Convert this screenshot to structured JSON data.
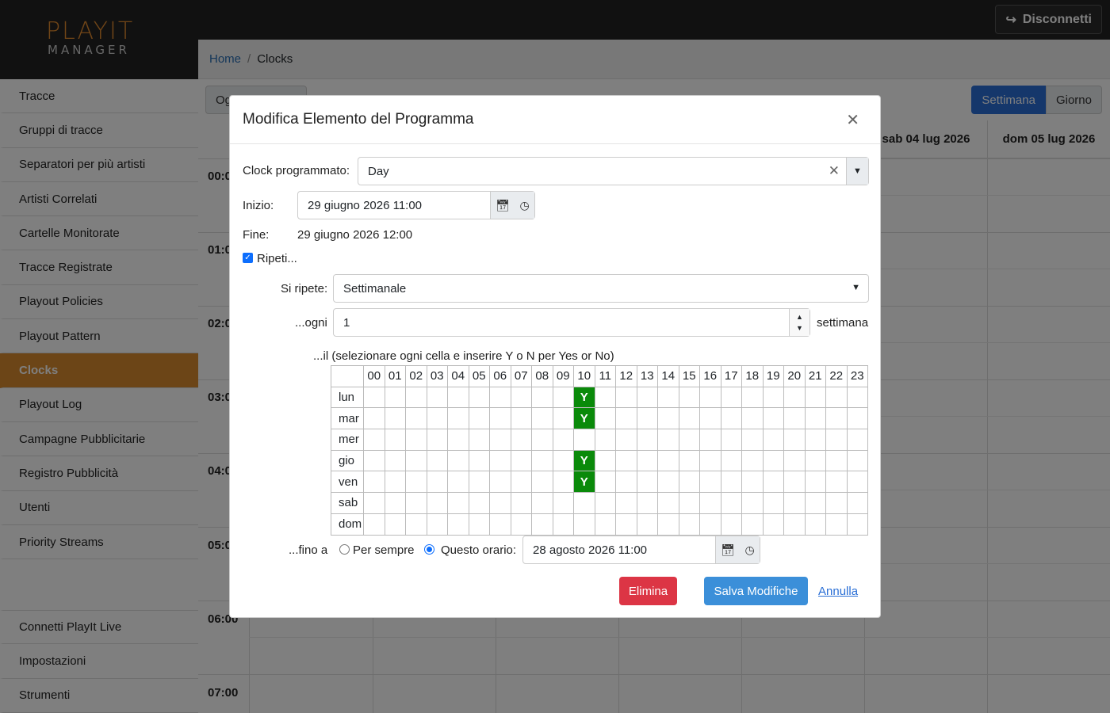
{
  "app": {
    "logo_main": "PLAYIT",
    "logo_sub": "MANAGER",
    "logout_label": "Disconnetti"
  },
  "breadcrumb": {
    "home": "Home",
    "current": "Clocks"
  },
  "sidebar": {
    "items": [
      {
        "label": "Tracce"
      },
      {
        "label": "Gruppi di tracce"
      },
      {
        "label": "Separatori per più artisti"
      },
      {
        "label": "Artisti Correlati"
      },
      {
        "label": "Cartelle Monitorate"
      },
      {
        "label": "Tracce Registrate"
      },
      {
        "label": "Playout Policies"
      },
      {
        "label": "Playout Pattern"
      },
      {
        "label": "Clocks"
      },
      {
        "label": "Playout Log"
      },
      {
        "label": "Campagne Pubblicitarie"
      },
      {
        "label": "Registro Pubblicità"
      },
      {
        "label": "Utenti"
      },
      {
        "label": "Priority Streams"
      }
    ],
    "bottom": [
      {
        "label": "Connetti PlayIt Live"
      },
      {
        "label": "Impostazioni"
      },
      {
        "label": "Strumenti"
      }
    ]
  },
  "calendar": {
    "today_btn": "Og",
    "view_week": "Settimana",
    "view_day": "Giorno",
    "col_sat": "sab 04 lug 2026",
    "col_sun": "dom 05 lug 2026",
    "hours": [
      "00:0",
      "01:0",
      "02:0",
      "03:0",
      "04:0",
      "05:0",
      "06:00",
      "07:00"
    ]
  },
  "modal": {
    "title": "Modifica Elemento del Programma",
    "clock_label": "Clock programmato:",
    "clock_value": "Day",
    "start_label": "Inizio:",
    "start_value": "29 giugno 2026 11:00",
    "end_label": "Fine:",
    "end_value": "29 giugno 2026 12:00",
    "repeat_label": "Ripeti...",
    "repeats_label": "Si ripete:",
    "repeats_value": "Settimanale",
    "every_label": "...ogni",
    "every_value": "1",
    "every_unit": "settimana",
    "grid_label": "...il (selezionare ogni cella e inserire Y o N per Yes or No)",
    "hours": [
      "00",
      "01",
      "02",
      "03",
      "04",
      "05",
      "06",
      "07",
      "08",
      "09",
      "10",
      "11",
      "12",
      "13",
      "14",
      "15",
      "16",
      "17",
      "18",
      "19",
      "20",
      "21",
      "22",
      "23"
    ],
    "days": [
      {
        "label": "lun",
        "yes_hours": [
          10
        ]
      },
      {
        "label": "mar",
        "yes_hours": [
          10
        ]
      },
      {
        "label": "mer",
        "yes_hours": []
      },
      {
        "label": "gio",
        "yes_hours": [
          10
        ]
      },
      {
        "label": "ven",
        "yes_hours": [
          10
        ]
      },
      {
        "label": "sab",
        "yes_hours": []
      },
      {
        "label": "dom",
        "yes_hours": []
      }
    ],
    "yes_mark": "Y",
    "until_label": "...fino a",
    "forever_label": "Per sempre",
    "this_time_label": "Questo orario:",
    "until_value": "28 agosto 2026 11:00",
    "delete_btn": "Elimina",
    "save_btn": "Salva Modifiche",
    "cancel_btn": "Annulla"
  }
}
